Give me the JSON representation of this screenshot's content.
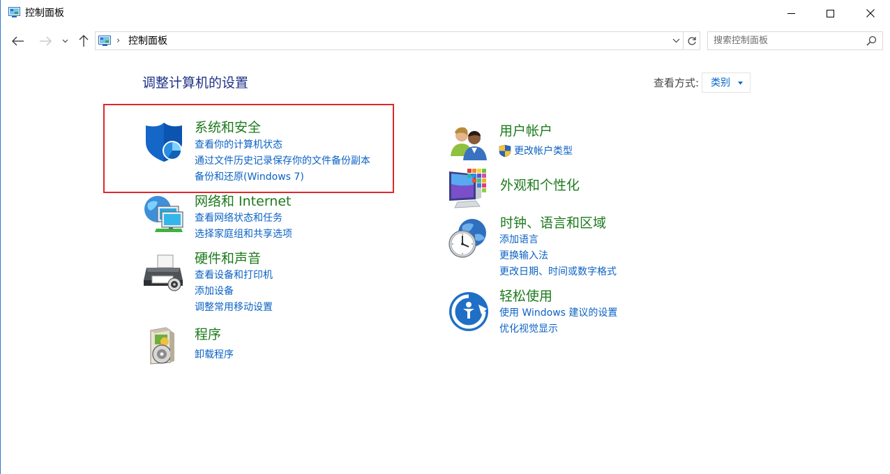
{
  "window": {
    "title": "控制面板"
  },
  "address": {
    "separator": "›",
    "crumb": "控制面板"
  },
  "search": {
    "placeholder": "搜索控制面板",
    "value": ""
  },
  "main": {
    "title": "调整计算机的设置",
    "view_label": "查看方式:",
    "view_value": "类别"
  },
  "categories": {
    "system_security": {
      "title": "系统和安全",
      "links": [
        "查看你的计算机状态",
        "通过文件历史记录保存你的文件备份副本",
        "备份和还原(Windows 7)"
      ]
    },
    "network": {
      "title": "网络和 Internet",
      "links": [
        "查看网络状态和任务",
        "选择家庭组和共享选项"
      ]
    },
    "hardware": {
      "title": "硬件和声音",
      "links": [
        "查看设备和打印机",
        "添加设备",
        "调整常用移动设置"
      ]
    },
    "programs": {
      "title": "程序",
      "links": [
        "卸载程序"
      ]
    },
    "user_accounts": {
      "title": "用户帐户",
      "links": [
        "更改帐户类型"
      ]
    },
    "appearance": {
      "title": "外观和个性化",
      "links": []
    },
    "clock_region": {
      "title": "时钟、语言和区域",
      "links": [
        "添加语言",
        "更换输入法",
        "更改日期、时间或数字格式"
      ]
    },
    "ease_of_access": {
      "title": "轻松使用",
      "links": [
        "使用 Windows 建议的设置",
        "优化视觉显示"
      ]
    }
  },
  "colors": {
    "accent_link": "#0b62c4",
    "category_title": "#1d7a1d",
    "page_title": "#1e3287",
    "highlight_border": "#e0262a"
  },
  "icons": {
    "title": "control-panel-icon",
    "system_security": "shield-icon",
    "network": "network-globe-icon",
    "hardware": "printer-icon",
    "programs": "programs-disc-icon",
    "user_accounts": "users-icon",
    "appearance": "monitor-palette-icon",
    "clock_region": "clock-globe-icon",
    "ease_of_access": "ease-of-access-icon"
  }
}
